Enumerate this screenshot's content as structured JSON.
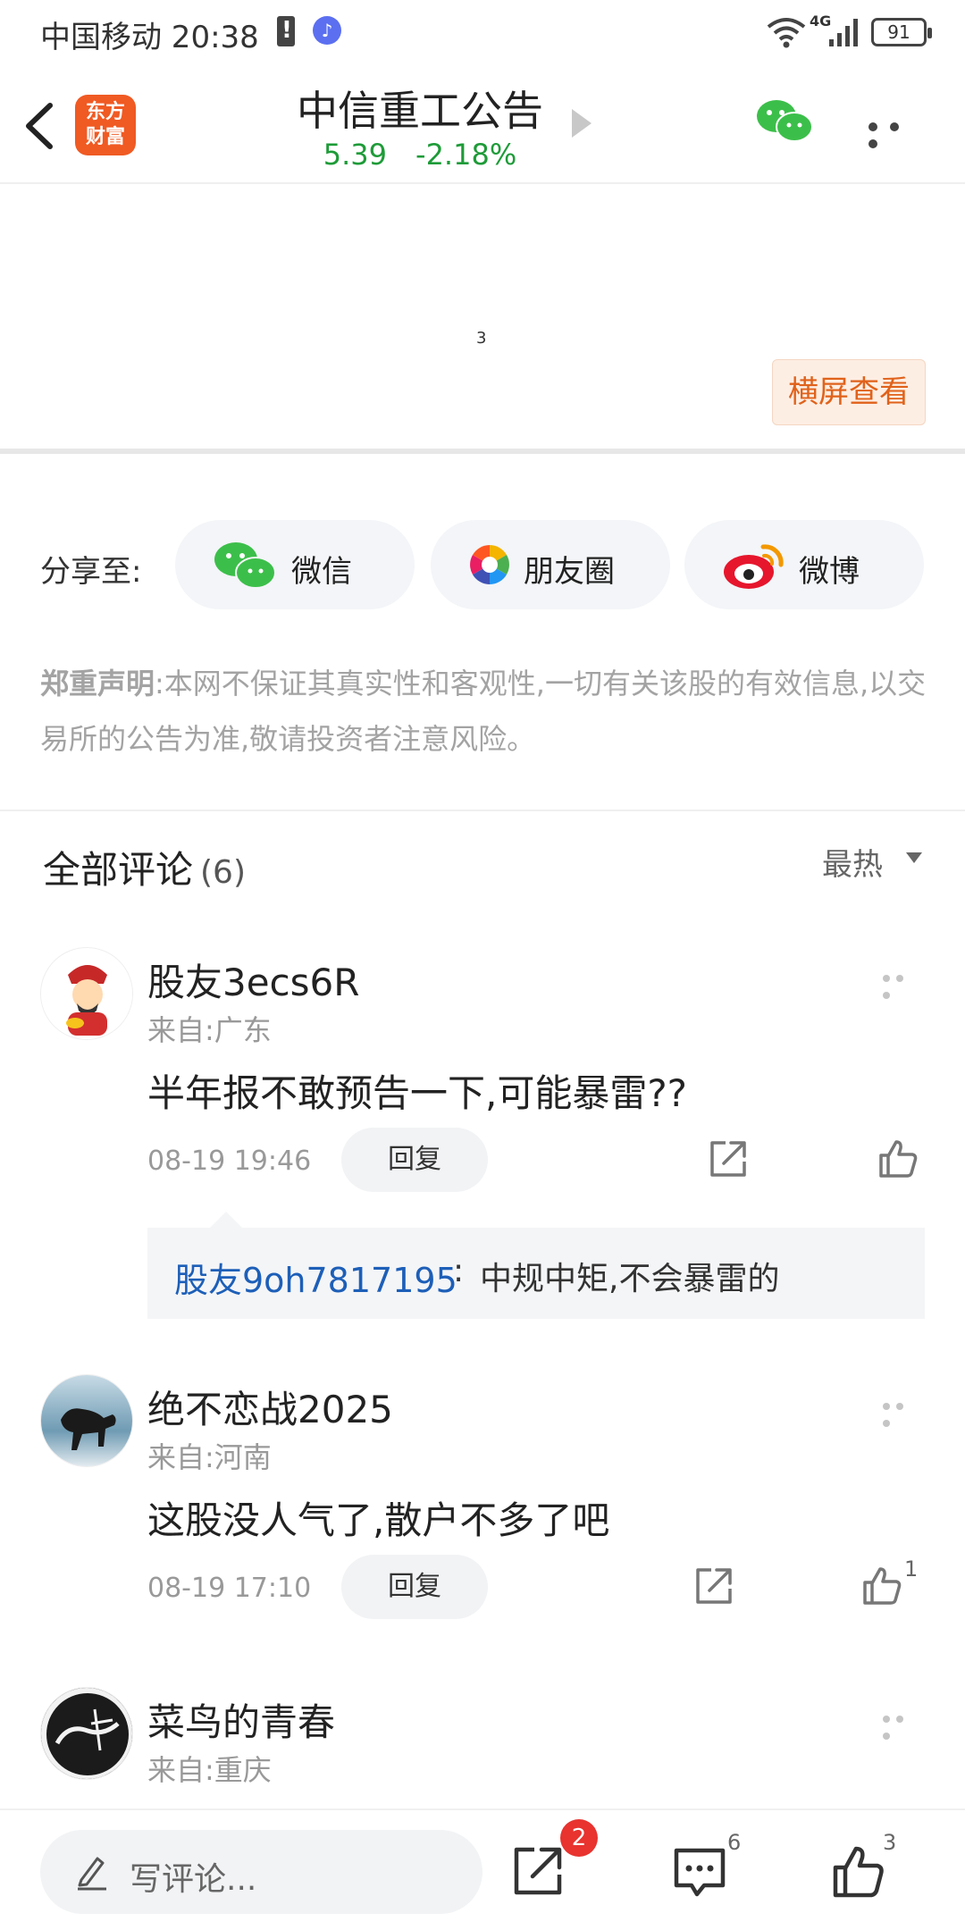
{
  "status_bar": {
    "carrier_time": "中国移动 20:38",
    "network": "4G",
    "battery": "91"
  },
  "header": {
    "logo_text": "东方\n财富",
    "logo_line1": "东方",
    "logo_line2": "财富",
    "title": "中信重工公告",
    "price": "5.39",
    "change": "-2.18%"
  },
  "document": {
    "page_number": "3",
    "landscape_label": "横屏查看"
  },
  "share": {
    "label": "分享至:",
    "wechat": "微信",
    "moments": "朋友圈",
    "weibo": "微博"
  },
  "disclaimer": {
    "heading": "郑重声明",
    "text": ":本网不保证其真实性和客观性,一切有关该股的有效信息,以交易所的公告为准,敬请投资者注意风险。"
  },
  "comments_header": {
    "title": "全部评论",
    "count": "(6)",
    "sort": "最热"
  },
  "comments": [
    {
      "user": "股友3ecs6R",
      "location": "来自:广东",
      "text": "半年报不敢预告一下,可能暴雷??",
      "time": "08-19 19:46",
      "reply_label": "回复",
      "likes": "",
      "sub_reply": {
        "user": "股友9oh7817195",
        "separator": ":",
        "text": "中规中矩,不会暴雷的"
      }
    },
    {
      "user": "绝不恋战2025",
      "location": "来自:河南",
      "text": "这股没人气了,散户不多了吧",
      "time": "08-19 17:10",
      "reply_label": "回复",
      "likes": "1"
    },
    {
      "user": "菜鸟的青春",
      "location": "来自:重庆"
    }
  ],
  "bottom_bar": {
    "write_placeholder": "写评论...",
    "share_badge": "2",
    "comment_count": "6",
    "like_count": "3"
  },
  "colors": {
    "up_down_green": "#1e9b38",
    "accent_orange": "#e0621b",
    "badge_red": "#e8332f",
    "link_blue": "#1d5fb8"
  }
}
